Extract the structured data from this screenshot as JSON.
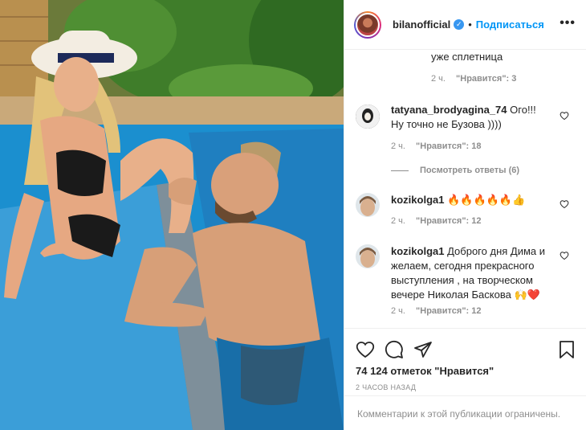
{
  "post": {
    "username": "bilanofficial",
    "follow_label": "Подписаться",
    "dot": "•",
    "more": "•••"
  },
  "comments": [
    {
      "text": "уже сплетница",
      "time": "2 ч.",
      "likes": "\"Нравится\": 3"
    },
    {
      "username": "tatyana_brodyagina_74",
      "text": "Ого!!! Ну точно не Бузова ))))",
      "time": "2 ч.",
      "likes": "\"Нравится\": 18",
      "view_replies": "Посмотреть ответы (6)"
    },
    {
      "username": "kozikolga1",
      "text": "🔥🔥🔥🔥🔥👍",
      "time": "2 ч.",
      "likes": "\"Нравится\": 12"
    },
    {
      "username": "kozikolga1",
      "text": "Доброго дня Дима и желаем, сегодня прекрасного выступления , на творческом вечере Николая Баскова 🙌❤️",
      "time": "2 ч.",
      "likes": "\"Нравится\": 12"
    }
  ],
  "actions": {
    "likes_count": "74 124 отметок \"Нравится\"",
    "time_ago": "2 ЧАСОВ НАЗАД",
    "comments_limited": "Комментарии к этой публикации ограничены."
  },
  "icons": [
    "verified-icon",
    "more-options-icon",
    "heart-icon",
    "comment-icon",
    "share-icon",
    "bookmark-icon"
  ],
  "colors": {
    "accent": "#0095f6",
    "text": "#262626",
    "muted": "#8e8e8e",
    "border": "#efefef"
  }
}
